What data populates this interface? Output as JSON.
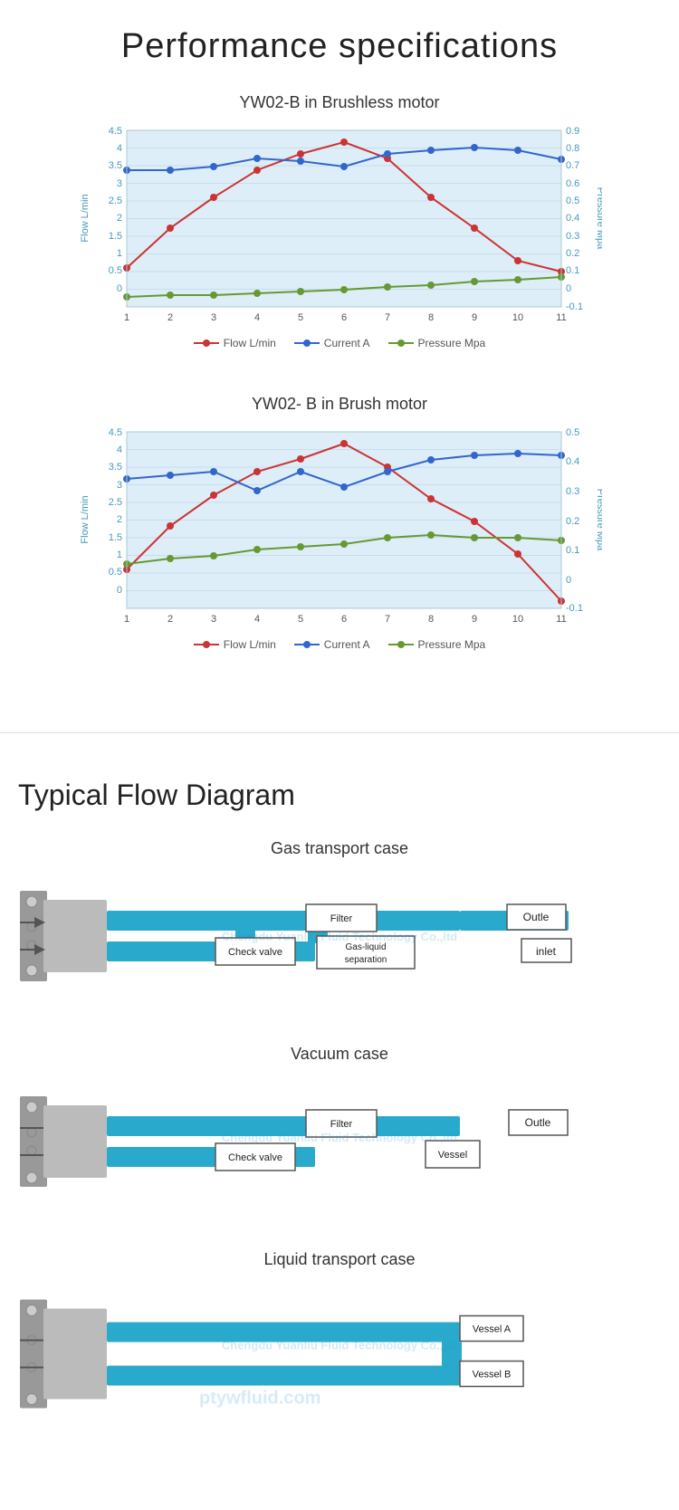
{
  "perf": {
    "title": "Performance specifications",
    "chart1": {
      "title": "YW02-B in Brushless motor",
      "legend": {
        "flow": "Flow L/min",
        "current": "Current A",
        "pressure": "Pressure Mpa"
      },
      "xLabels": [
        "1",
        "2",
        "3",
        "4",
        "5",
        "6",
        "7",
        "8",
        "9",
        "10",
        "11"
      ],
      "yLeft": {
        "label": "Flow L/min",
        "min": 0,
        "max": 4.5,
        "step": 0.5
      },
      "yRight": {
        "label": "Pressure Mpa",
        "min": -0.1,
        "max": 0.9,
        "step": 0.1
      },
      "flowData": [
        1.0,
        2.0,
        2.8,
        3.5,
        3.9,
        4.2,
        3.8,
        2.8,
        2.0,
        1.2,
        0.9
      ],
      "currentData": [
        3.5,
        3.5,
        3.6,
        3.8,
        3.7,
        3.6,
        3.9,
        4.0,
        4.05,
        4.0,
        3.75
      ],
      "pressureData": [
        0.05,
        0.06,
        0.06,
        0.07,
        0.08,
        0.09,
        0.1,
        0.11,
        0.13,
        0.14,
        0.15
      ]
    },
    "chart2": {
      "title": "YW02- B in Brush motor",
      "legend": {
        "flow": "Flow L/min",
        "current": "Current A",
        "pressure": "Pressure Mpa"
      },
      "xLabels": [
        "1",
        "2",
        "3",
        "4",
        "5",
        "6",
        "7",
        "8",
        "9",
        "10",
        "11"
      ],
      "yLeft": {
        "label": "Flow L/min",
        "min": 0,
        "max": 4.5,
        "step": 0.5
      },
      "yRight": {
        "label": "Pressure Mpa",
        "min": -0.1,
        "max": 0.5,
        "step": 0.1
      },
      "flowData": [
        1.0,
        2.1,
        2.9,
        3.5,
        3.8,
        4.2,
        3.6,
        2.8,
        2.2,
        1.4,
        0.2
      ],
      "currentData": [
        3.3,
        3.4,
        3.5,
        3.0,
        3.5,
        3.1,
        3.5,
        3.8,
        3.9,
        3.95,
        3.9
      ],
      "pressureData": [
        0.05,
        0.07,
        0.08,
        0.1,
        0.11,
        0.12,
        0.14,
        0.15,
        0.14,
        0.14,
        0.13
      ]
    }
  },
  "flow": {
    "mainTitle": "Typical Flow Diagram",
    "cases": [
      {
        "title": "Gas transport case",
        "labels": [
          "Filter",
          "Outle",
          "Check valve",
          "Gas-liquid\nseparation",
          "inlet"
        ]
      },
      {
        "title": "Vacuum case",
        "labels": [
          "Filter",
          "Outle",
          "Check valve",
          "Vessel"
        ]
      },
      {
        "title": "Liquid transport case",
        "labels": [
          "Vessel A",
          "Vessel B"
        ]
      }
    ]
  },
  "watermark": "Chengdu Yuanliu Fluid Technology Co.,ltd"
}
